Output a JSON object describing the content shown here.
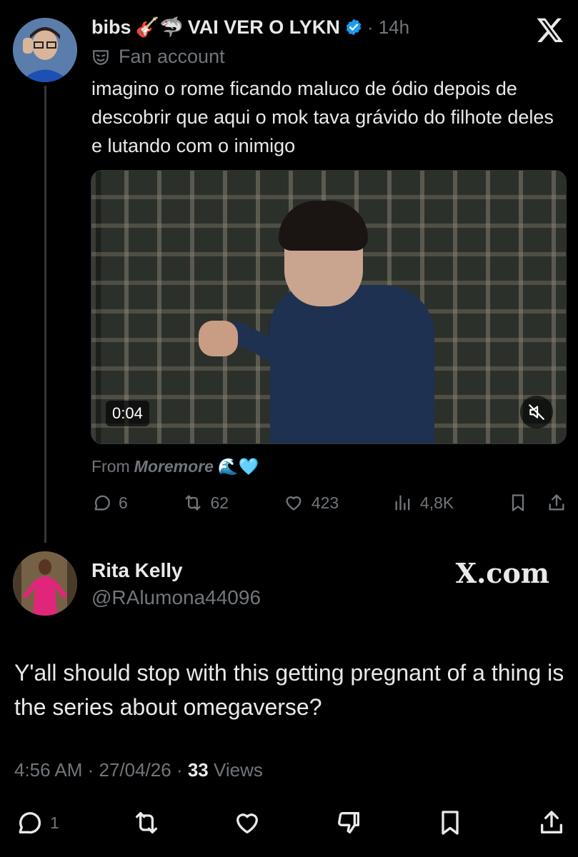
{
  "tweet1": {
    "display_name": "bibs",
    "emojis": "🎸🦈",
    "name_suffix": "VAI VER O LYKN",
    "time": "· 14h",
    "label": "Fan account",
    "text": "imagino o rome ficando maluco de ódio depois de descobrir que aqui o mok tava grávido do filhote deles e lutando com o inimigo",
    "video_time": "0:04",
    "from_prefix": "From",
    "from_source": "Moremore",
    "from_emojis": "🌊🩵",
    "replies": "6",
    "reposts": "62",
    "likes": "423",
    "views": "4,8K"
  },
  "tweet2": {
    "name": "Rita Kelly",
    "handle": "@RAlumona44096",
    "watermark": "X.com",
    "text": "Y'all should stop with this getting pregnant of a thing is the series about omegaverse?",
    "time": "4:56 AM · 27/04/26 ·",
    "views_count": "33",
    "views_label": "Views",
    "replies": "1"
  },
  "colors": {
    "background": "#000000",
    "text": "#e7e9ea",
    "muted": "#71767b",
    "verified": "#1d9bf0"
  },
  "icons": [
    "x-logo-icon",
    "verified-badge-icon",
    "fan-mask-icon",
    "mute-icon",
    "reply-icon",
    "repost-icon",
    "like-icon",
    "views-icon",
    "bookmark-icon",
    "share-icon",
    "dislike-icon"
  ]
}
